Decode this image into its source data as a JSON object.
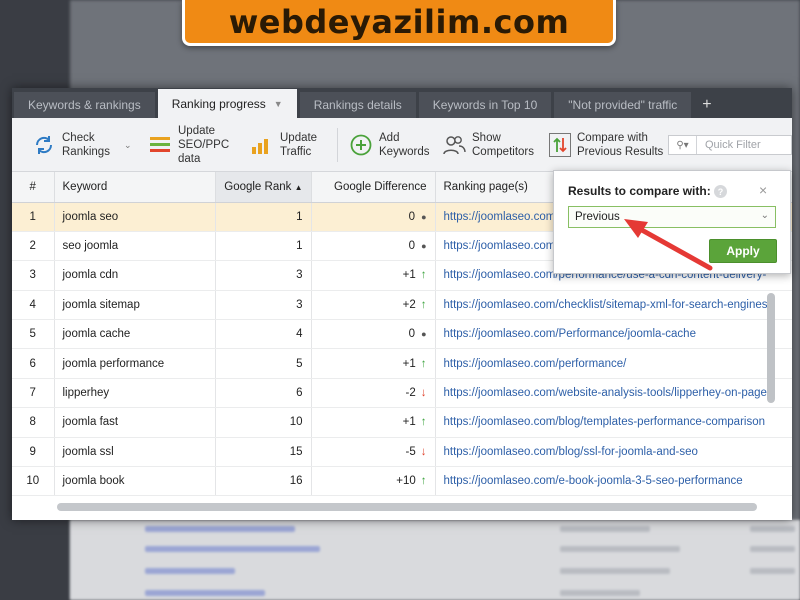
{
  "watermark": "webdeyazilim.com",
  "tabs": [
    {
      "label": "Keywords & rankings"
    },
    {
      "label": "Ranking progress"
    },
    {
      "label": "Rankings details"
    },
    {
      "label": "Keywords in Top 10"
    },
    {
      "label": "\"Not provided\" traffic"
    }
  ],
  "tab_add_label": "+",
  "toolbar": {
    "check_rankings": "Check\nRankings",
    "update_seo_ppc": "Update\nSEO/PPC\ndata",
    "update_traffic": "Update\nTraffic",
    "add_keywords": "Add\nKeywords",
    "show_competitors": "Show\nCompetitors",
    "compare_results": "Compare with\nPrevious Results",
    "quick_filter_placeholder": "Quick Filter"
  },
  "table": {
    "columns": [
      "#",
      "Keyword",
      "Google Rank",
      "Google Difference",
      "Ranking page(s)"
    ],
    "rows": [
      {
        "n": "1",
        "keyword": "joomla seo",
        "rank": "1",
        "diff": "0",
        "trend": "none",
        "page": "https://joomlaseo.com/"
      },
      {
        "n": "2",
        "keyword": "seo joomla",
        "rank": "1",
        "diff": "0",
        "trend": "none",
        "page": "https://joomlaseo.com/"
      },
      {
        "n": "3",
        "keyword": "joomla cdn",
        "rank": "3",
        "diff": "+1",
        "trend": "up",
        "page": "https://joomlaseo.com/performance/use-a-cdn-content-delivery-"
      },
      {
        "n": "4",
        "keyword": "joomla sitemap",
        "rank": "3",
        "diff": "+2",
        "trend": "up",
        "page": "https://joomlaseo.com/checklist/sitemap-xml-for-search-engines"
      },
      {
        "n": "5",
        "keyword": "joomla cache",
        "rank": "4",
        "diff": "0",
        "trend": "none",
        "page": "https://joomlaseo.com/Performance/joomla-cache"
      },
      {
        "n": "6",
        "keyword": "joomla performance",
        "rank": "5",
        "diff": "+1",
        "trend": "up",
        "page": "https://joomlaseo.com/performance/"
      },
      {
        "n": "7",
        "keyword": "lipperhey",
        "rank": "6",
        "diff": "-2",
        "trend": "down",
        "page": "https://joomlaseo.com/website-analysis-tools/lipperhey-on-page"
      },
      {
        "n": "8",
        "keyword": "joomla fast",
        "rank": "10",
        "diff": "+1",
        "trend": "up",
        "page": "https://joomlaseo.com/blog/templates-performance-comparison"
      },
      {
        "n": "9",
        "keyword": "joomla ssl",
        "rank": "15",
        "diff": "-5",
        "trend": "down",
        "page": "https://joomlaseo.com/blog/ssl-for-joomla-and-seo"
      },
      {
        "n": "10",
        "keyword": "joomla book",
        "rank": "16",
        "diff": "+10",
        "trend": "up",
        "page": "https://joomlaseo.com/e-book-joomla-3-5-seo-performance"
      }
    ]
  },
  "popup": {
    "title": "Results to compare with:",
    "help": "?",
    "close": "×",
    "selected": "Previous",
    "apply": "Apply"
  },
  "colors": {
    "accent_green": "#5ba43a",
    "trend_up": "#3ea540",
    "trend_down": "#e0432d",
    "link": "#2d5fa8",
    "selected_row": "#fcefd3",
    "annotation_arrow": "#e53935",
    "banner": "#f08a14"
  }
}
